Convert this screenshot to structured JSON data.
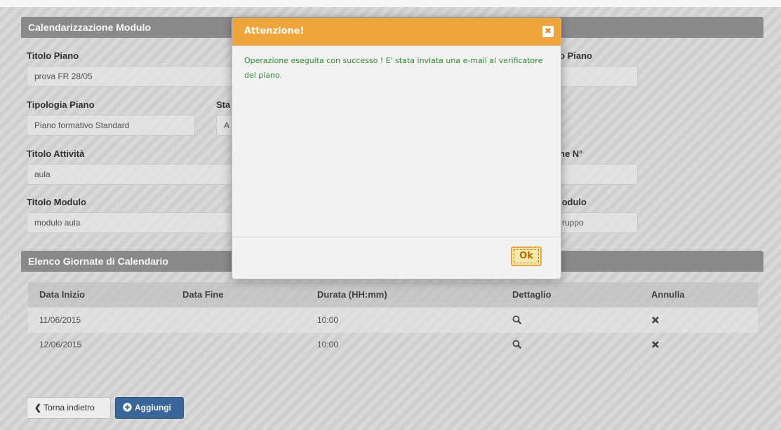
{
  "form": {
    "header": "Calendarizzazione Modulo",
    "titolo_piano_label": "Titolo Piano",
    "titolo_piano_value": "prova FR 28/05",
    "registro_piano_label": "o Piano",
    "tipologia_label": "Tipologia Piano",
    "tipologia_value": "Piano formativo Standard",
    "stato_label": "Sta",
    "stato_value": "A",
    "titolo_attivita_label": "Titolo Attività",
    "titolo_attivita_value": "aula",
    "edizione_label": "ne N°",
    "titolo_modulo_label": "Titolo Modulo",
    "titolo_modulo_value": "modulo aula",
    "tipo_modulo_label": "lodulo",
    "tipo_modulo_value": "ruppo"
  },
  "calendar": {
    "header": "Elenco Giornate di Calendario",
    "columns": [
      "Data Inizio",
      "Data Fine",
      "Durata (HH:mm)",
      "Dettaglio",
      "Annulla"
    ],
    "rows": [
      {
        "start": "11/06/2015",
        "end": "",
        "duration": "10:00"
      },
      {
        "start": "12/06/2015",
        "end": "",
        "duration": "10:00"
      }
    ]
  },
  "buttons": {
    "back": "Torna indietro",
    "add": "Aggiungi"
  },
  "modal": {
    "title": "Attenzione!",
    "message": "Operazione eseguita con successo ! E' stata inviata una e-mail al verificatore del piano.",
    "ok": "Ok"
  },
  "icons": {
    "detail": "search-icon",
    "cancel": "close-icon",
    "back": "chevron-left-icon",
    "add": "plus-circle-icon"
  },
  "colors": {
    "modal_header": "#f0a53a",
    "success_text": "#2e8b2e",
    "primary_button": "#3c6a9c",
    "panel_header": "#8f8f8f"
  }
}
